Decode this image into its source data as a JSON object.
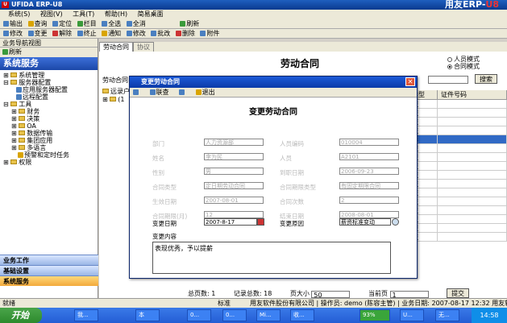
{
  "app": {
    "title": "UFIDA ERP-U8",
    "brand_text": "用友ERP-",
    "brand_accent": "U8"
  },
  "menu": [
    "系统(S)",
    "视图(V)",
    "工具(T)",
    "帮助(H)",
    "简易桌面"
  ],
  "toolbar1": [
    "输出",
    "查询",
    "定位",
    "栏目",
    "全选",
    "全消",
    "刷新"
  ],
  "toolbar2": [
    "修改",
    "变更",
    "解除",
    "终止",
    "通知",
    "修改",
    "批改",
    "删除",
    "附件"
  ],
  "left": {
    "header": "业务导航视图",
    "refresh": "刷新",
    "title": "系统服务",
    "tree": [
      "系统管理",
      "服务器配置",
      "应用服务器配置",
      "远程配置",
      "工具",
      "财务",
      "决策",
      "OA",
      "数据传输",
      "集团应用",
      "多语言",
      "预警和定时任务",
      "权限"
    ],
    "bottom": [
      "业务工作",
      "基础设置",
      "系统服务"
    ]
  },
  "main": {
    "tabs": [
      "劳动合同",
      "协议"
    ],
    "title": "劳动合同",
    "radio": [
      "人员模式",
      "合同模式"
    ],
    "filter_label": "劳动合同",
    "search_btn": "搜索",
    "tree_root": "远录户",
    "grid_headers": [
      "证件类型",
      "证件号码"
    ],
    "grid_value": "身份证",
    "pager": {
      "total_pages_label": "总页数",
      "total_pages": "1",
      "total_records_label": "记录总数",
      "total_records": "18",
      "page_size_label": "页大小",
      "page_size": "50",
      "current_label": "当前页",
      "current": "1",
      "submit": "提交"
    }
  },
  "dialog": {
    "title": "变更劳动合同",
    "tools": [
      "联查",
      "退出"
    ],
    "heading": "变更劳动合同",
    "fields": [
      {
        "label": "部门",
        "value": "人力资源部"
      },
      {
        "label": "人员编码",
        "value": "010004"
      },
      {
        "label": "姓名",
        "value": "李为民"
      },
      {
        "label": "人员",
        "value": "A2101"
      },
      {
        "label": "性别",
        "value": "男"
      },
      {
        "label": "到职日期",
        "value": "2006-09-23"
      },
      {
        "label": "合同类型",
        "value": "定日期劳动合同"
      },
      {
        "label": "合同期限类型",
        "value": "有固定期限合同"
      },
      {
        "label": "生效日期",
        "value": "2007-08-01"
      },
      {
        "label": "合同次数",
        "value": "2"
      },
      {
        "label": "合同期限(月)",
        "value": "12"
      },
      {
        "label": "结束日期",
        "value": "2008-08-01"
      }
    ],
    "change_date_label": "变更日期",
    "change_date": "2007-8-17",
    "change_reason_label": "变更原因",
    "change_reason": "薪资标准变动",
    "content_label": "变更内容",
    "content": "表现优秀，予以提薪"
  },
  "status": {
    "left": "就绪",
    "right": "用友软件股份有限公司 | 操作员: demo (陈容主管) | 业务日期: 2007-08-17 12:32 用友软件"
  },
  "taskbar": {
    "start": "开始",
    "buttons": [
      "我...",
      "本",
      "0...",
      "0...",
      "Mi...",
      "收...",
      "93%",
      "U...",
      "无..."
    ],
    "clock": "14:58",
    "ime": "标准"
  }
}
